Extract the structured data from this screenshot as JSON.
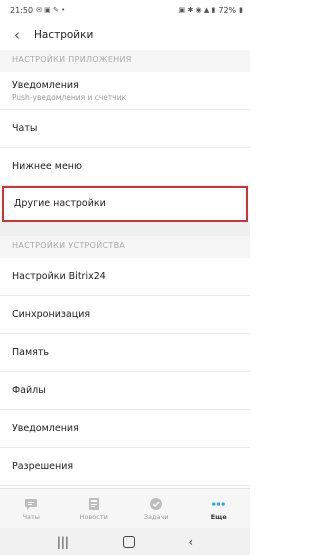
{
  "status": {
    "time": "21:50",
    "battery": "72%"
  },
  "appbar": {
    "title": "Настройки"
  },
  "app_section": {
    "header": "НАСТРОЙКИ ПРИЛОЖЕНИЯ",
    "items": [
      {
        "label": "Уведомления",
        "sublabel": "Push-уведомления и счетчик"
      },
      {
        "label": "Чаты"
      },
      {
        "label": "Нижнее меню"
      },
      {
        "label": "Другие настройки"
      }
    ]
  },
  "device_section": {
    "header": "НАСТРОЙКИ УСТРОЙСТВА",
    "items": [
      {
        "label": "Настройки Bitrix24"
      },
      {
        "label": "Синхронизация"
      },
      {
        "label": "Память"
      },
      {
        "label": "Файлы"
      },
      {
        "label": "Уведомления"
      },
      {
        "label": "Разрешения"
      }
    ]
  },
  "bottom_nav": {
    "tabs": [
      {
        "label": "Чаты",
        "icon": "chat-icon"
      },
      {
        "label": "Новости",
        "icon": "news-icon"
      },
      {
        "label": "Задачи",
        "icon": "tasks-check-icon"
      },
      {
        "label": "Еще",
        "icon": "more-dots-icon",
        "active": true
      }
    ]
  },
  "colors": {
    "highlight": "#d0323b",
    "accent": "#2fa8d5"
  }
}
